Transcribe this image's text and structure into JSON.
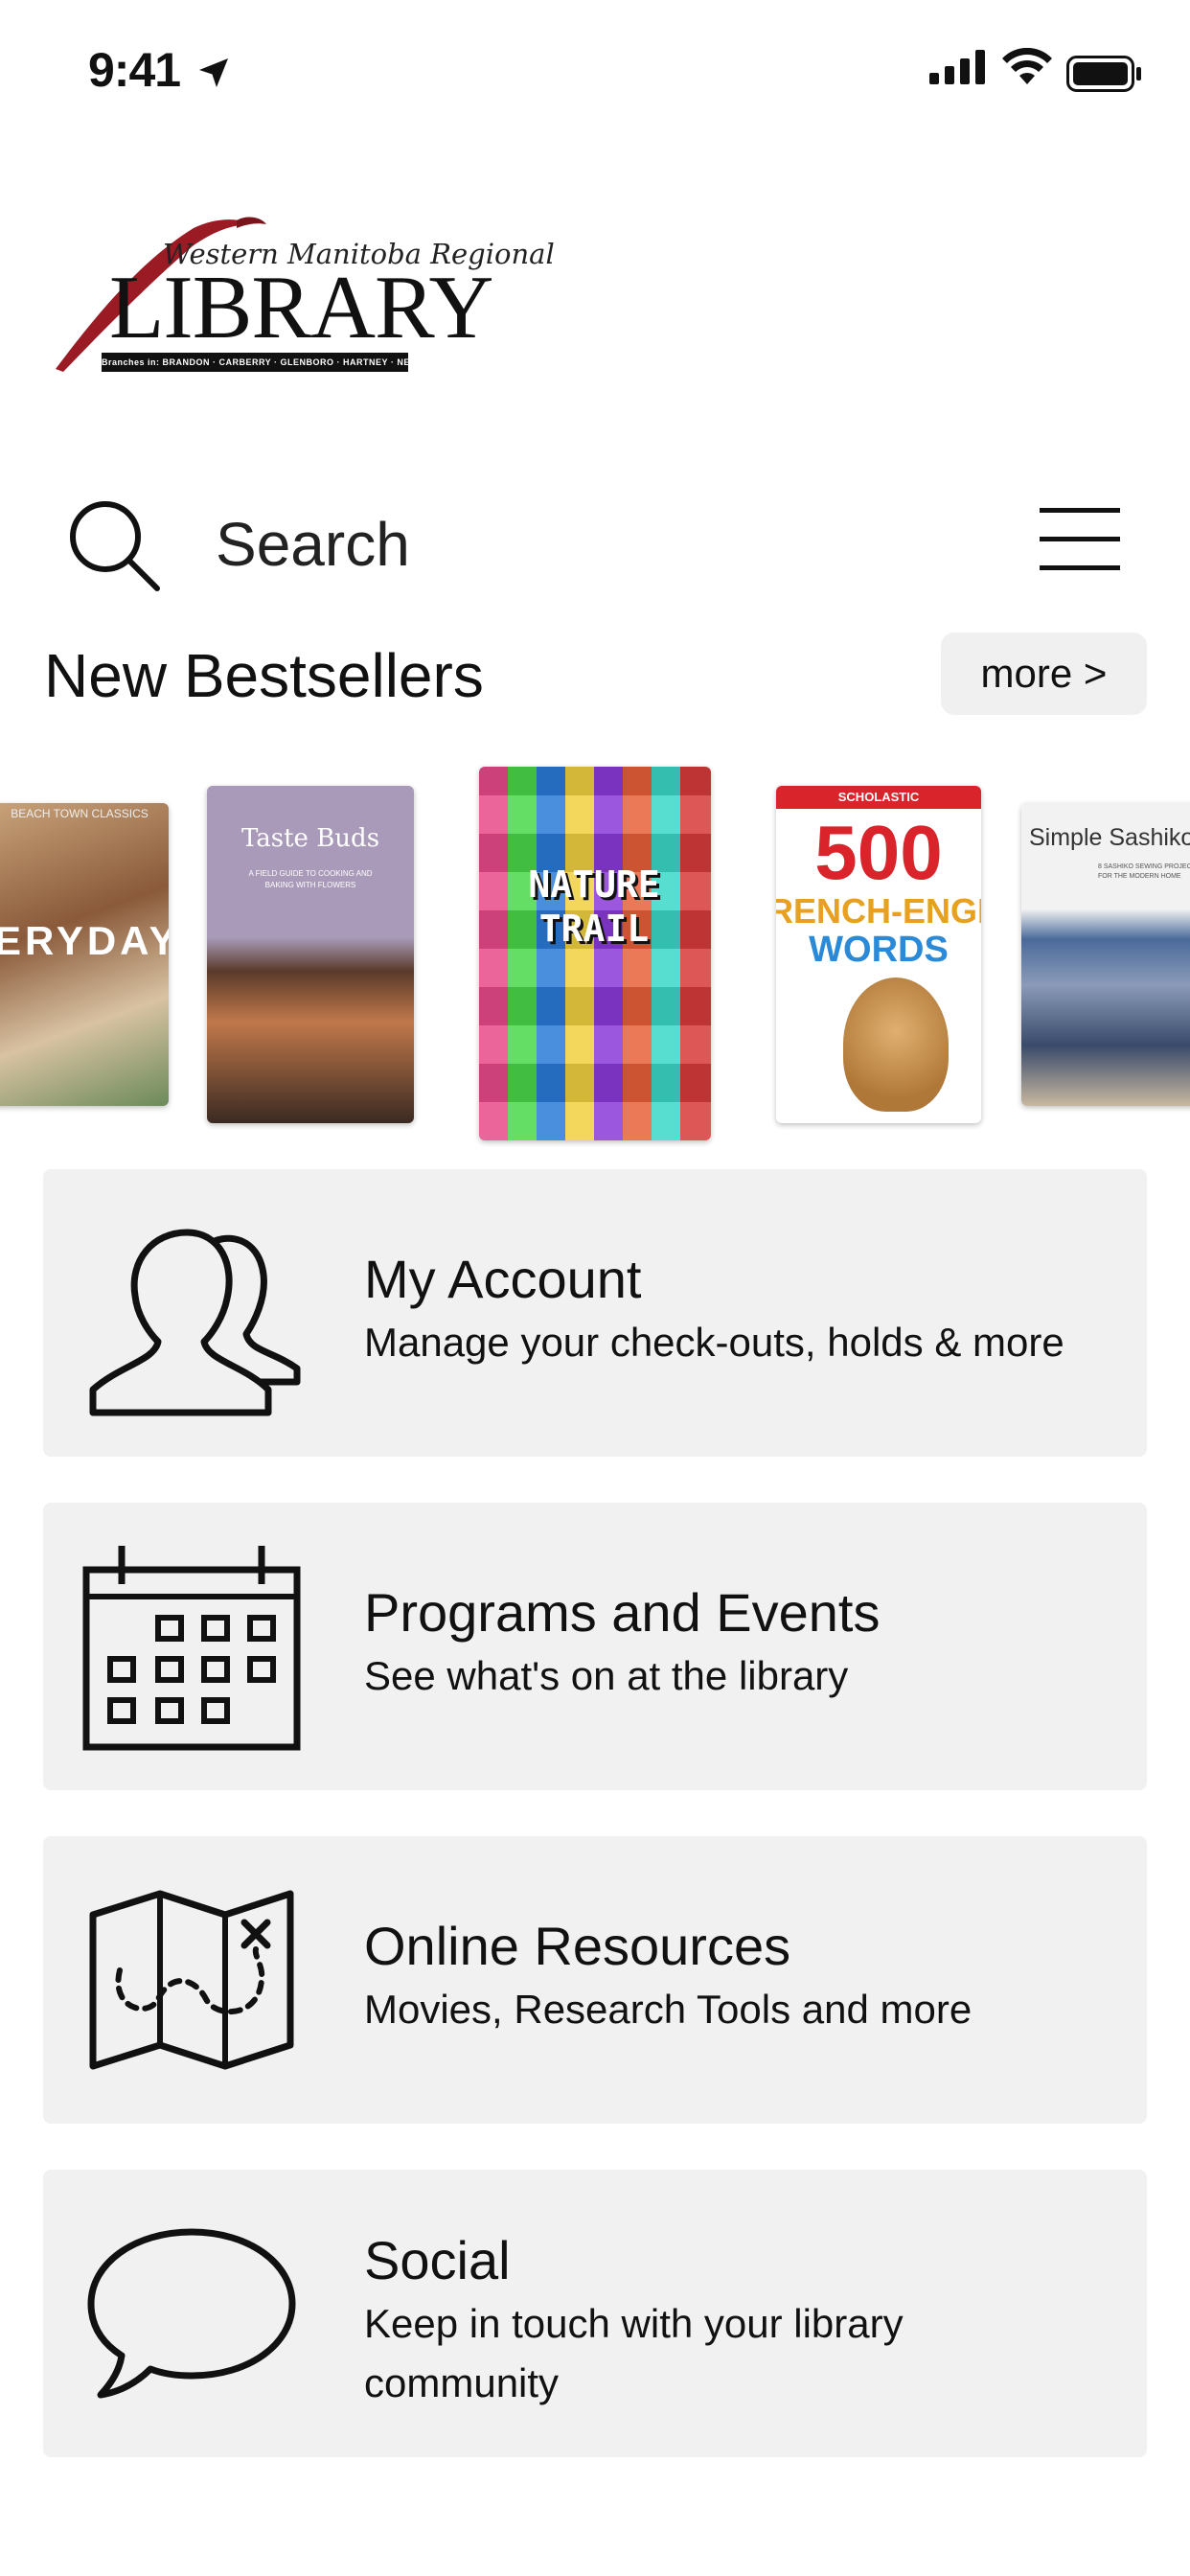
{
  "status_bar": {
    "time": "9:41"
  },
  "logo": {
    "subtitle": "Western Manitoba Regional",
    "title": "LIBRARY",
    "branches": "Branches in: BRANDON · CARBERRY · GLENBORO · HARTNEY · NEEPAWA"
  },
  "search": {
    "placeholder": "Search"
  },
  "bestsellers": {
    "title": "New Bestsellers",
    "more_label": "more >",
    "books": [
      {
        "title": "EVERYDAY",
        "series": "BEACH TOWN CLASSICS"
      },
      {
        "title": "Taste Buds",
        "subtitle": "A FIELD GUIDE TO COOKING AND BAKING WITH FLOWERS"
      },
      {
        "title": "NATURE TRAIL"
      },
      {
        "title": "500",
        "line2": "FRENCH-ENGLISH",
        "line3": "WORDS",
        "publisher": "SCHOLASTIC"
      },
      {
        "title": "Simple Sashiko",
        "subtitle": "8 SASHIKO SEWING PROJECTS FOR THE MODERN HOME"
      }
    ]
  },
  "menu": [
    {
      "title": "My Account",
      "description": "Manage your check-outs, holds & more",
      "icon": "users-icon"
    },
    {
      "title": "Programs and Events",
      "description": "See what's on at the library",
      "icon": "calendar-icon"
    },
    {
      "title": "Online Resources",
      "description": "Movies, Research Tools and more",
      "icon": "map-icon"
    },
    {
      "title": "Social",
      "description": "Keep in touch with your library community",
      "icon": "speech-bubble-icon"
    }
  ]
}
